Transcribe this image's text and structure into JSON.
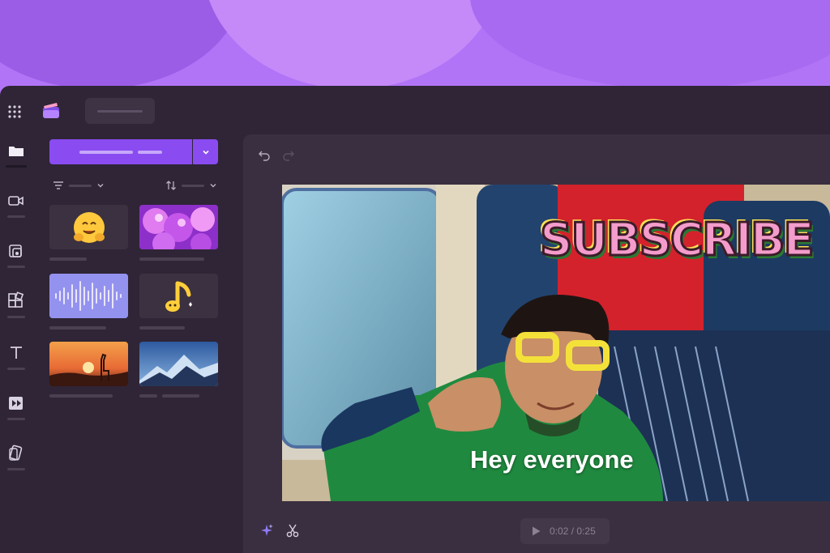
{
  "colors": {
    "background": "#b174f7",
    "app_bg": "#2f2536",
    "canvas_bg": "#3a2f40",
    "accent": "#8a4cf0"
  },
  "topbar": {
    "apps_icon": "grid-icon",
    "logo_icon": "clipchamp-logo-icon"
  },
  "rail": {
    "items": [
      {
        "name": "your-media",
        "icon": "folder-icon",
        "active": true
      },
      {
        "name": "record-create",
        "icon": "camera-icon"
      },
      {
        "name": "content-library",
        "icon": "library-icon"
      },
      {
        "name": "templates",
        "icon": "templates-icon"
      },
      {
        "name": "text",
        "icon": "text-icon"
      },
      {
        "name": "transitions",
        "icon": "transitions-icon"
      },
      {
        "name": "brand-kit",
        "icon": "brandkit-icon"
      }
    ]
  },
  "library": {
    "tiles": [
      {
        "type": "emoji",
        "emoji": "🤗",
        "bg": "#3c3140"
      },
      {
        "type": "image",
        "desc": "purple bubbles",
        "bg": "#c255e6"
      },
      {
        "type": "audio",
        "desc": "waveform",
        "bg": "#8f8ef0"
      },
      {
        "type": "emoji",
        "emoji": "🎵",
        "bg": "#3c3140"
      },
      {
        "type": "image",
        "desc": "sunset giraffe",
        "bg": "#e08a3e"
      },
      {
        "type": "image",
        "desc": "mountains",
        "bg": "#3a6fb5"
      }
    ]
  },
  "video": {
    "caption": "Hey everyone",
    "sticker": "SUBSCRIBE"
  },
  "playback": {
    "current_time": "0:02",
    "separator": "/",
    "total_time": "0:25"
  }
}
